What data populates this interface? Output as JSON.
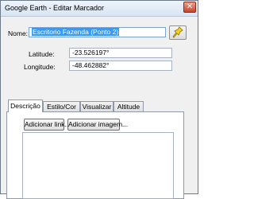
{
  "window": {
    "title": "Google Earth - Editar Marcador",
    "close_symbol": "✕"
  },
  "form": {
    "name_label": "Nome:",
    "name_value": "Escritorio Fazenda (Ponto 2)",
    "latitude_label": "Latitude:",
    "latitude_value": "-23.526197°",
    "longitude_label": "Longitude:",
    "longitude_value": "-48.462882°"
  },
  "icon_button": {
    "icon": "pushpin-icon",
    "color": "#f2d21b"
  },
  "tabs": [
    {
      "label": "Descrição",
      "active": true
    },
    {
      "label": "Estilo/Cor",
      "active": false
    },
    {
      "label": "Visualizar",
      "active": false
    },
    {
      "label": "Altitude",
      "active": false
    }
  ],
  "description": {
    "add_link_label": "Adicionar link...",
    "add_image_label": "Adicionar imagem..."
  }
}
